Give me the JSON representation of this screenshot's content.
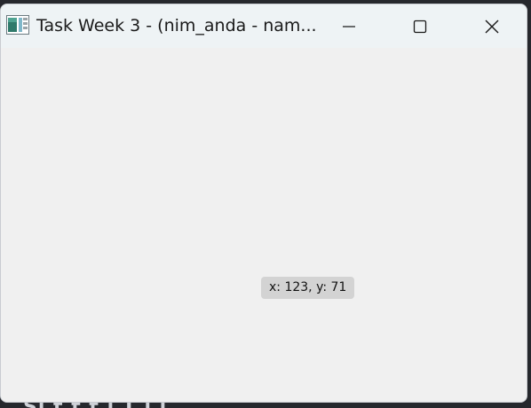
{
  "window": {
    "title": "Task Week 3 - (nim_anda - nam...",
    "controls": {
      "minimize_icon": "minimize-icon",
      "maximize_icon": "maximize-icon",
      "close_icon": "close-icon"
    }
  },
  "content": {
    "coordinate_readout": "x: 123, y: 71"
  },
  "desktop": {
    "partial_text": "Si      t  t  t  i  T  l  i"
  },
  "colors": {
    "titlebar": "#eef3f5",
    "content": "#f0f0f0",
    "tooltip": "#d3d3d3"
  }
}
